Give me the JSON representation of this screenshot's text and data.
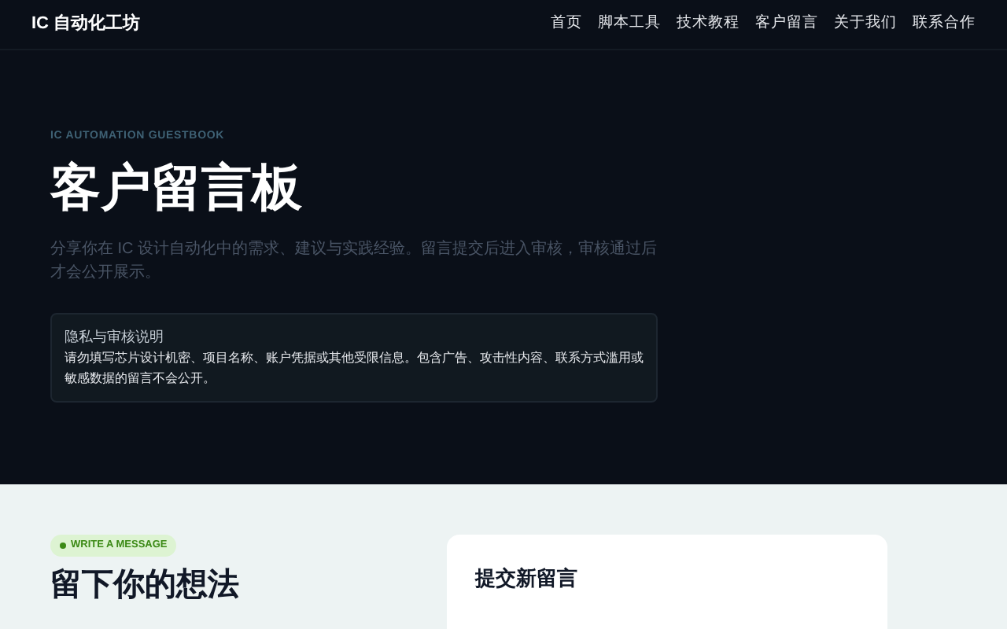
{
  "header": {
    "logo": "IC 自动化工坊",
    "nav": [
      "首页",
      "脚本工具",
      "技术教程",
      "客户留言",
      "关于我们",
      "联系合作"
    ]
  },
  "hero": {
    "eyebrow": "IC AUTOMATION GUESTBOOK",
    "title": "客户留言板",
    "subtitle": "分享你在 IC 设计自动化中的需求、建议与实践经验。留言提交后进入审核，审核通过后才会公开展示。",
    "notice": {
      "title": "隐私与审核说明",
      "body": "请勿填写芯片设计机密、项目名称、账户凭据或其他受限信息。包含广告、攻击性内容、联系方式滥用或敏感数据的留言不会公开。"
    }
  },
  "write": {
    "badge": "WRITE A MESSAGE",
    "heading": "留下你的想法",
    "form_title": "提交新留言"
  }
}
